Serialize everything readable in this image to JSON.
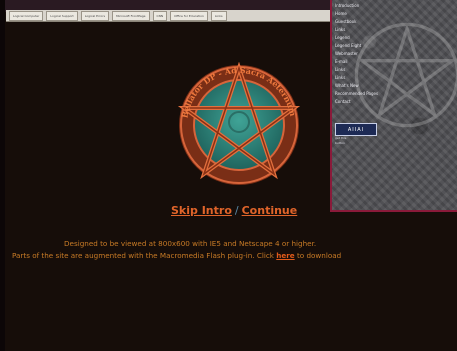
{
  "toolbar": {
    "buttons": [
      "Logical Computer",
      "Logical Support",
      "Logical Errors",
      "Microsoft FrontPage",
      "CNN",
      "Office for Education",
      "Links"
    ]
  },
  "side_panel": {
    "menu": [
      "Introduction",
      "Home",
      "Guestbook",
      "Links",
      "Legend",
      "Legend Eight",
      "Webmaster",
      "E-mail",
      "Links",
      "Links",
      "What's New",
      "Recommended Pages",
      "Contact"
    ],
    "badge": "AIIAI",
    "badge_note": [
      "get this",
      "button"
    ]
  },
  "emblem": {
    "ring_text": "Bellator DP - Ad Sacra Aeternum"
  },
  "links": {
    "skip": "Skip Intro",
    "separator": "/",
    "continue": "Continue"
  },
  "info": {
    "line1": "Designed to be viewed at 800x600 with IE5 and Netscape 4 or higher.",
    "line2_pre": "Parts of the site are augmented with the Macromedia Flash plug-in. Click ",
    "line2_link": "here",
    "line2_post": " to download"
  },
  "colors": {
    "background": "#160d09",
    "accent_orange": "#e0642a",
    "emblem_teal": "#2f8c80",
    "panel_border": "#8a1a3a"
  }
}
